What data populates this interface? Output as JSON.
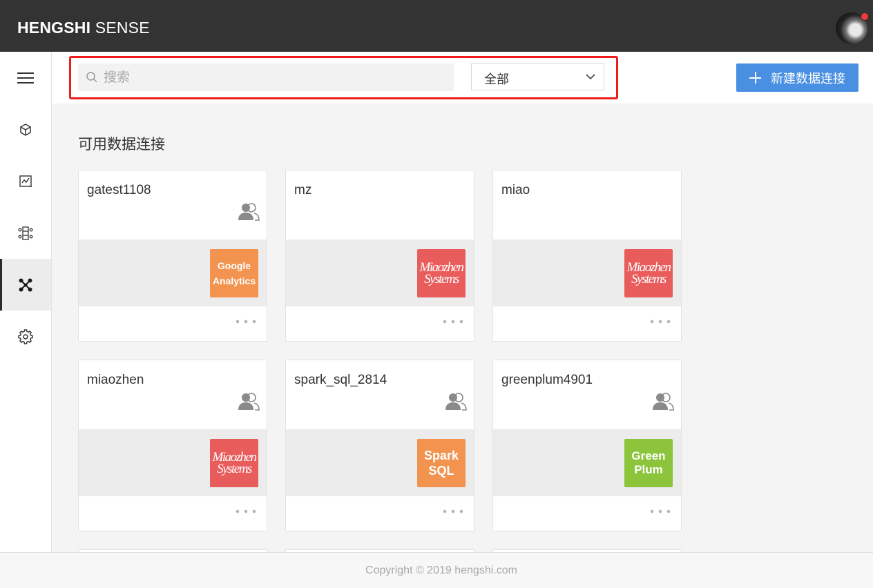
{
  "header": {
    "brand_bold": "HENGSHI",
    "brand_light": " SENSE"
  },
  "sidebar": {
    "items": [
      {
        "icon": "menu-icon"
      },
      {
        "icon": "cube-icon"
      },
      {
        "icon": "chart-icon"
      },
      {
        "icon": "data-app-icon"
      },
      {
        "icon": "data-connection-icon",
        "active": true
      },
      {
        "icon": "gear-icon"
      }
    ]
  },
  "toolbar": {
    "search_placeholder": "搜索",
    "filter_value": "全部",
    "new_button_label": "新建数据连接"
  },
  "section_title": "可用数据连接",
  "cards": [
    {
      "name": "gatest1108",
      "shared": true,
      "logo": {
        "lines": [
          "Google",
          "Analytics"
        ],
        "type": "google"
      }
    },
    {
      "name": "mz",
      "shared": false,
      "logo": {
        "lines": [
          "Miaozhen",
          "Systems"
        ],
        "type": "miaozhen"
      }
    },
    {
      "name": "miao",
      "shared": false,
      "logo": {
        "lines": [
          "Miaozhen",
          "Systems"
        ],
        "type": "miaozhen"
      }
    },
    {
      "name": "miaozhen",
      "shared": true,
      "logo": {
        "lines": [
          "Miaozhen",
          "Systems"
        ],
        "type": "miaozhen"
      }
    },
    {
      "name": "spark_sql_2814",
      "shared": true,
      "logo": {
        "lines": [
          "Spark",
          "SQL"
        ],
        "type": "spark"
      }
    },
    {
      "name": "greenplum4901",
      "shared": true,
      "logo": {
        "lines": [
          "Green",
          "Plum"
        ],
        "type": "greenplum"
      }
    }
  ],
  "footer": {
    "text": "Copyright © 2019 hengshi.com"
  },
  "colors": {
    "topbar": "#333333",
    "primary": "#4a90e2",
    "highlight": "#ee1c1c",
    "google": "#f29450",
    "miaozhen": "#e85c5c",
    "spark": "#f29450",
    "greenplum": "#8cc43c"
  }
}
